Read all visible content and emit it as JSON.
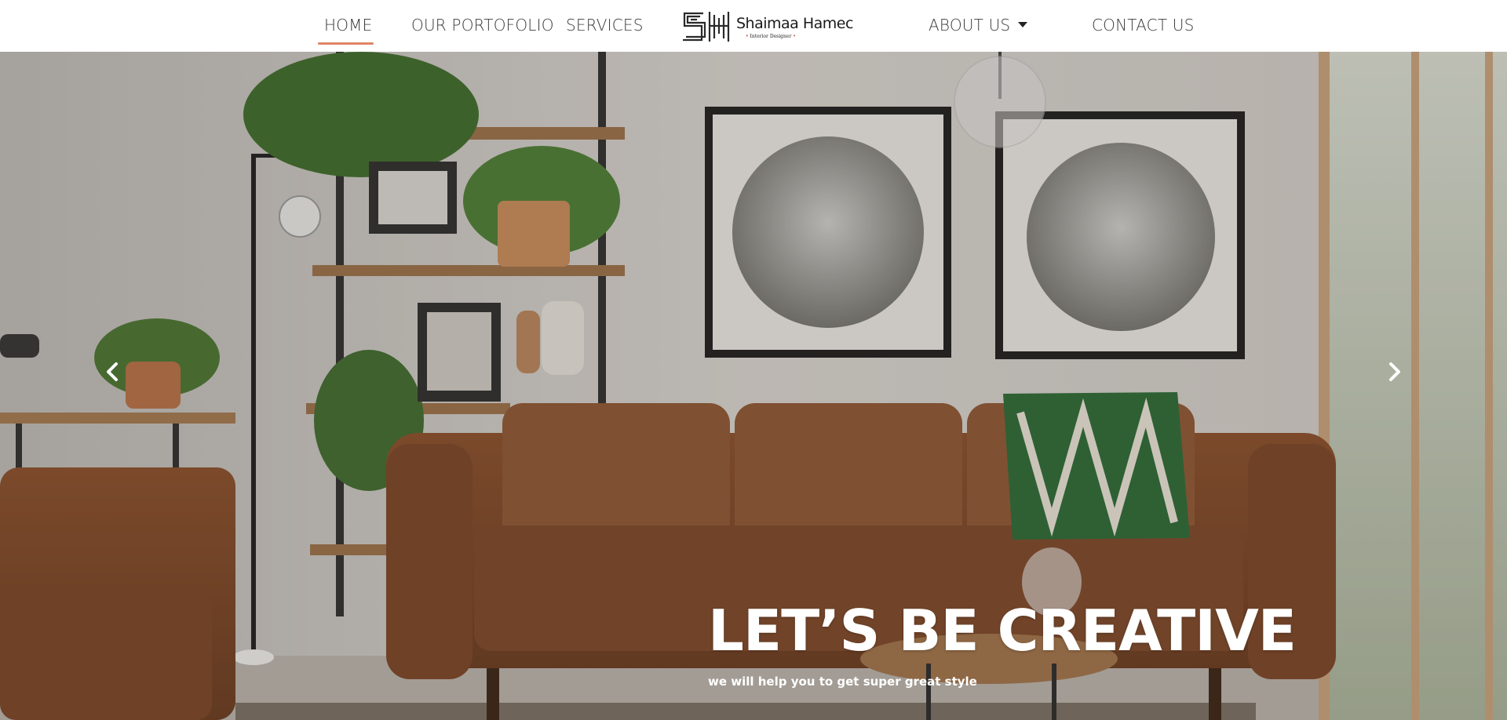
{
  "nav": {
    "items": [
      {
        "label": "HOME",
        "active": true
      },
      {
        "label": "OUR PORTOFOLIO"
      },
      {
        "label": "SERVICES"
      },
      {
        "label": "ABOUT US"
      },
      {
        "label": "CONTACT US"
      }
    ],
    "accent_color": "#e08566"
  },
  "logo": {
    "initials": "SH",
    "name": "Shaimaa Hamec",
    "tagline": "Interior Designer"
  },
  "hero": {
    "title": "LET’S BE CREATIVE",
    "subtitle": "we will help you to get super great style",
    "prev_icon": "chevron-left-icon",
    "next_icon": "chevron-right-icon"
  }
}
